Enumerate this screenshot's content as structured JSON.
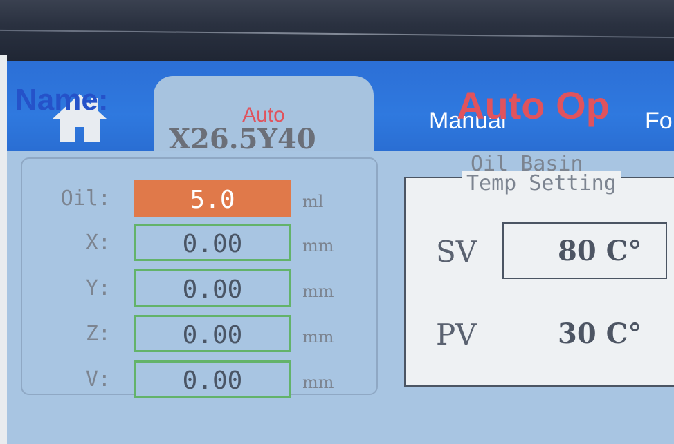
{
  "tabs": {
    "home_icon": "home-icon",
    "auto_label": "Auto",
    "manual_label": "Manual",
    "next_label": "Fo"
  },
  "name": {
    "label": "Name:",
    "value": "X26.5Y40"
  },
  "params": [
    {
      "label": "Oil:",
      "value": "5.0",
      "unit": "ml"
    },
    {
      "label": "X:",
      "value": "0.00",
      "unit": "mm"
    },
    {
      "label": "Y:",
      "value": "0.00",
      "unit": "mm"
    },
    {
      "label": "Z:",
      "value": "0.00",
      "unit": "mm"
    },
    {
      "label": "V:",
      "value": "0.00",
      "unit": "mm"
    }
  ],
  "auto_panel": {
    "title": "Auto Op",
    "subtitle": "Oil Basin",
    "temp_title": "Temp Setting",
    "sv_label": "SV",
    "sv_value": "80 C°",
    "pv_label": "PV",
    "pv_value": "30 C°"
  },
  "colors": {
    "tab_bar": "#2f79df",
    "active_tab": "#a7c3df",
    "accent_red": "#e0535d",
    "name_blue": "#2552c9",
    "oil_field": "#e0794a",
    "field_border": "#63b36a",
    "panel_bg": "#a8c5e2"
  }
}
